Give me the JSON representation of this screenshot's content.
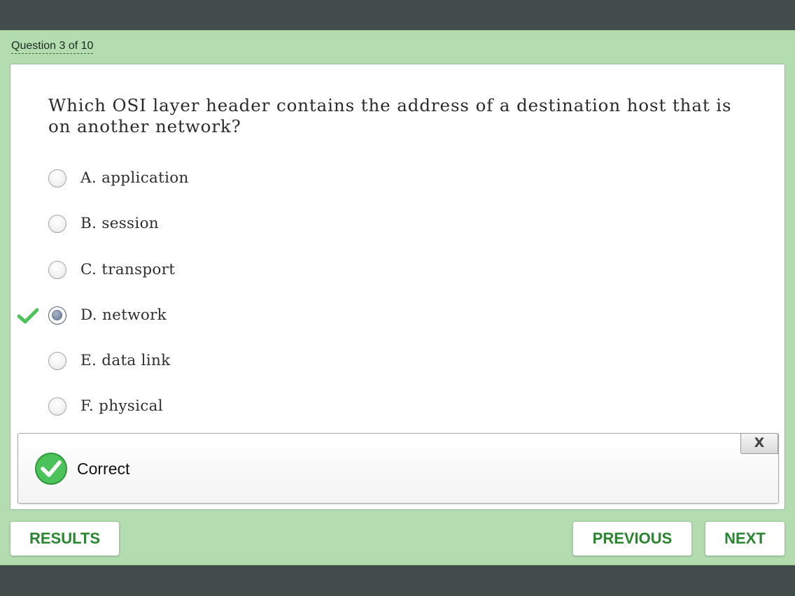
{
  "header": {
    "counter": "Question 3 of 10"
  },
  "question": {
    "text": "Which OSI layer header contains the address of a destination host that is on another network?"
  },
  "options": [
    {
      "label": "A. application",
      "selected": false,
      "marked_correct": false
    },
    {
      "label": "B. session",
      "selected": false,
      "marked_correct": false
    },
    {
      "label": "C. transport",
      "selected": false,
      "marked_correct": false
    },
    {
      "label": "D. network",
      "selected": true,
      "marked_correct": true
    },
    {
      "label": "E. data link",
      "selected": false,
      "marked_correct": false
    },
    {
      "label": "F. physical",
      "selected": false,
      "marked_correct": false
    }
  ],
  "feedback": {
    "status_text": "Correct",
    "icon": "check-circle-icon",
    "close_label": "X"
  },
  "footer": {
    "results_label": "RESULTS",
    "previous_label": "PREVIOUS",
    "next_label": "NEXT"
  },
  "colors": {
    "frame_green": "#b3dcb1",
    "button_text_green": "#28862e",
    "correct_green": "#4cc35a",
    "background_dark": "#424d4b"
  }
}
